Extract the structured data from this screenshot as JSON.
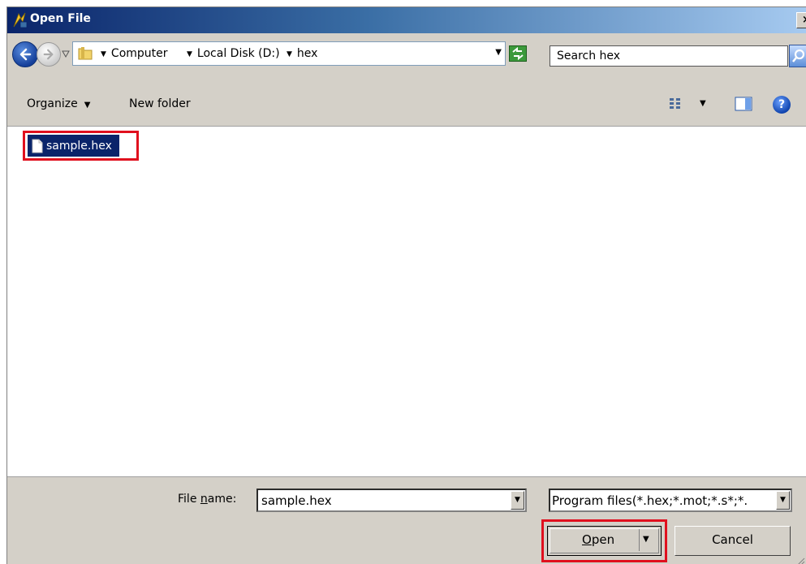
{
  "window": {
    "title": "Open File",
    "close_label": "×"
  },
  "address_bar": {
    "breadcrumbs": [
      "Computer",
      "Local Disk (D:)",
      "hex"
    ],
    "search_placeholder": "Search hex"
  },
  "toolbar": {
    "organize_label": "Organize",
    "new_folder_label": "New folder",
    "help_label": "?"
  },
  "files": [
    {
      "name": "sample.hex",
      "selected": true
    }
  ],
  "bottom": {
    "file_name_label_pre": "File ",
    "file_name_label_u": "n",
    "file_name_label_post": "ame:",
    "file_name_value": "sample.hex",
    "file_type_value": "Program files(*.hex;*.mot;*.s*;*.",
    "open_label_u": "O",
    "open_label_rest": "pen",
    "cancel_label": "Cancel"
  },
  "colors": {
    "selection": "#0a246a",
    "highlight": "#e0101e",
    "dialog_bg": "#d4d0c8"
  }
}
